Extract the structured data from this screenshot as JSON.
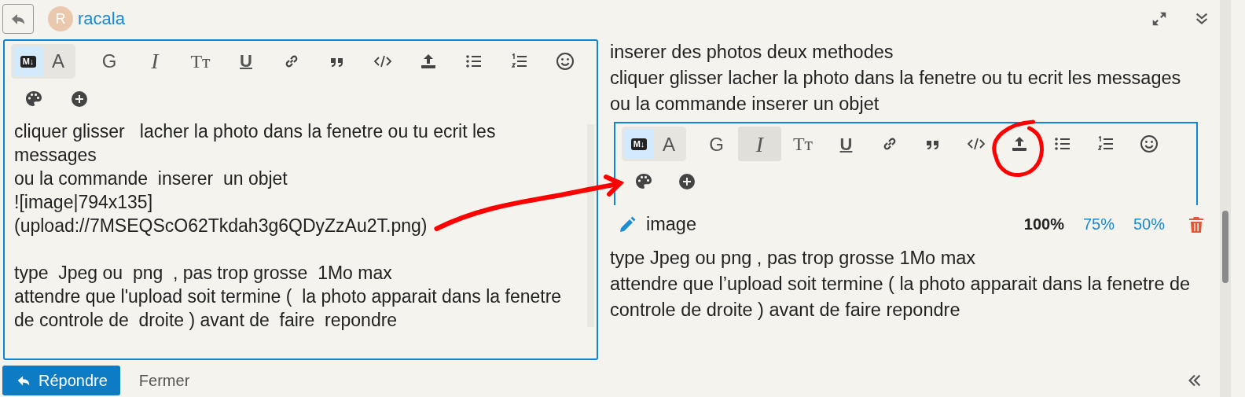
{
  "header": {
    "avatar_letter": "R",
    "username": "racala"
  },
  "editor": {
    "toolbar": [
      {
        "kind": "mode-markdown",
        "label": "M↓",
        "selected": true,
        "hovered": false
      },
      {
        "kind": "mode-rich",
        "label": "A",
        "selected": false,
        "hovered": false
      },
      {
        "kind": "letter",
        "label": "G",
        "hovered": false
      },
      {
        "kind": "italic-letter",
        "label": "I",
        "hovered": false
      },
      {
        "kind": "letter",
        "label": "Tт",
        "hovered": false
      },
      {
        "kind": "underline-letter",
        "label": "U",
        "hovered": false
      },
      {
        "kind": "icon",
        "hovered": false
      },
      {
        "kind": "icon",
        "hovered": false
      },
      {
        "kind": "icon",
        "hovered": false
      },
      {
        "kind": "icon",
        "hovered": false
      },
      {
        "kind": "icon",
        "hovered": false
      },
      {
        "kind": "icon",
        "hovered": false
      },
      {
        "kind": "icon",
        "hovered": false
      },
      {
        "kind": "icon",
        "hovered": false
      },
      {
        "kind": "icon",
        "hovered": false
      }
    ],
    "paragraphs": [
      [
        "cliquer glisser   lacher la photo dans la fenetre ou tu ecrit les messages",
        "ou la commande  inserer  un objet",
        "![image|794x135]",
        "(upload://7MSEQScO62Tkdah3g6QDyZzAu2T.png)"
      ],
      [
        "type  Jpeg ou  png  , pas trop grosse  1Mo max",
        "attendre que l'upload soit termine (  la photo apparait dans la fenetre de controle de  droite ) avant de  faire  repondre"
      ]
    ]
  },
  "preview": {
    "lines_before": [
      "inserer des photos deux methodes",
      "cliquer glisser lacher la photo dans la fenetre ou tu ecrit les messages",
      "ou la commande inserer un objet"
    ],
    "embedded_image": {
      "toolbar": [
        {
          "kind": "mode-markdown",
          "label": "M↓",
          "selected": true,
          "hovered": false
        },
        {
          "kind": "mode-rich",
          "label": "A",
          "selected": false,
          "hovered": false
        },
        {
          "kind": "letter",
          "label": "G",
          "hovered": false
        },
        {
          "kind": "italic-letter",
          "label": "I",
          "hovered": true
        },
        {
          "kind": "letter",
          "label": "Tт",
          "hovered": false
        },
        {
          "kind": "underline-letter",
          "label": "U",
          "hovered": false
        },
        {
          "kind": "icon",
          "hovered": false
        },
        {
          "kind": "icon",
          "hovered": false
        },
        {
          "kind": "icon",
          "hovered": false
        },
        {
          "kind": "icon",
          "hovered": false
        },
        {
          "kind": "icon",
          "hovered": false
        },
        {
          "kind": "icon",
          "hovered": false
        },
        {
          "kind": "icon",
          "hovered": false
        },
        {
          "kind": "icon",
          "hovered": false
        },
        {
          "kind": "icon",
          "hovered": false
        }
      ]
    },
    "image_controls": {
      "name": "image",
      "sizes": [
        {
          "label": "100%",
          "selected": true
        },
        {
          "label": "75%",
          "selected": false
        },
        {
          "label": "50%",
          "selected": false
        }
      ]
    },
    "lines_after": [
      "type Jpeg ou png , pas trop grosse 1Mo max",
      "attendre que l’upload soit termine ( la photo apparait dans la fenetre de controle de droite ) avant de faire repondre"
    ]
  },
  "annotations": {
    "arrow": true,
    "circle": true
  },
  "footer": {
    "reply_button": "Répondre",
    "close_link": "Fermer"
  }
}
